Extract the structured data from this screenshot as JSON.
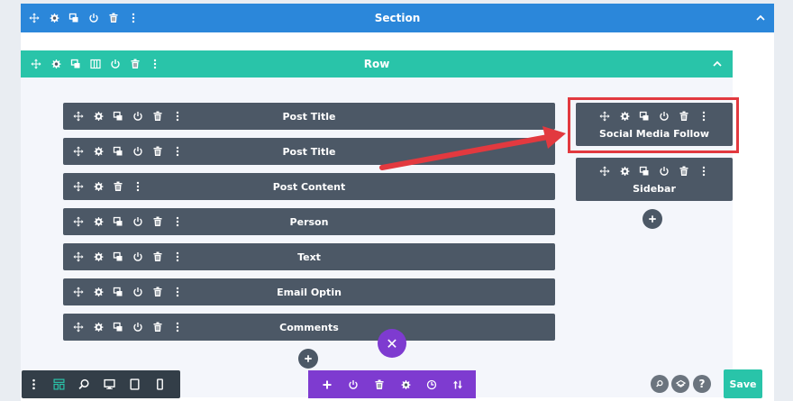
{
  "section": {
    "title": "Section"
  },
  "row": {
    "title": "Row"
  },
  "left_column_modules": [
    {
      "title": "Post Title"
    },
    {
      "title": "Post Title"
    },
    {
      "title": "Post Content"
    },
    {
      "title": "Person"
    },
    {
      "title": "Text"
    },
    {
      "title": "Email Optin"
    },
    {
      "title": "Comments"
    }
  ],
  "right_column_modules": [
    {
      "title": "Social Media Follow",
      "highlighted": true
    },
    {
      "title": "Sidebar"
    }
  ],
  "icons": {
    "move": "move-icon",
    "settings": "gear-icon",
    "duplicate": "duplicate-icon",
    "columns": "columns-icon",
    "toggle": "power-icon",
    "delete": "trash-icon",
    "more": "more-icon",
    "collapse": "chevron-up-icon",
    "add": "plus-icon",
    "close": "close-icon"
  },
  "bottom_left_toolbar": [
    "more-icon",
    "wireframe-icon",
    "zoom-icon",
    "desktop-icon",
    "tablet-icon",
    "phone-icon"
  ],
  "bottom_mid_toolbar": [
    "plus-icon",
    "power-icon",
    "trash-icon",
    "gear-icon",
    "history-icon",
    "sort-icon"
  ],
  "bottom_right": {
    "icons": [
      "search-icon",
      "layers-icon",
      "help-icon"
    ],
    "save_label": "Save"
  },
  "colors": {
    "section_bar": "#2b87da",
    "row_bar": "#29c4a9",
    "module": "#4c5866",
    "builder_bar": "#7e3bd0",
    "highlight": "#e2393f",
    "save": "#29c4a9"
  }
}
